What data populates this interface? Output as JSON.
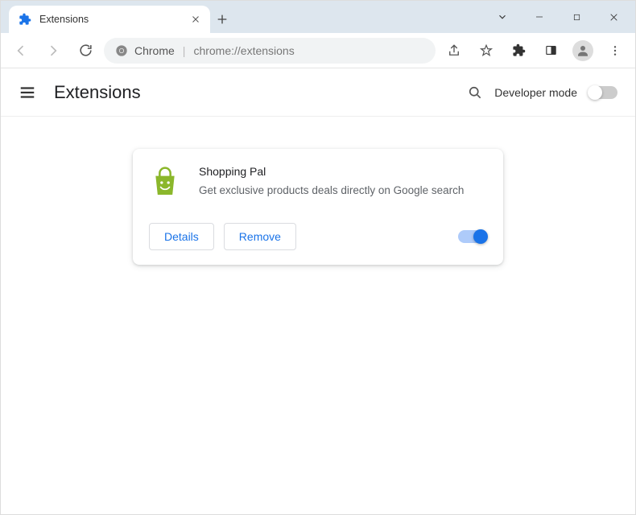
{
  "window": {
    "tab_title": "Extensions"
  },
  "omnibox": {
    "chip_label": "Chrome",
    "url": "chrome://extensions"
  },
  "page": {
    "title": "Extensions",
    "developer_mode_label": "Developer mode"
  },
  "extension": {
    "name": "Shopping Pal",
    "description": "Get exclusive products deals directly on Google search",
    "details_label": "Details",
    "remove_label": "Remove",
    "enabled": true
  }
}
